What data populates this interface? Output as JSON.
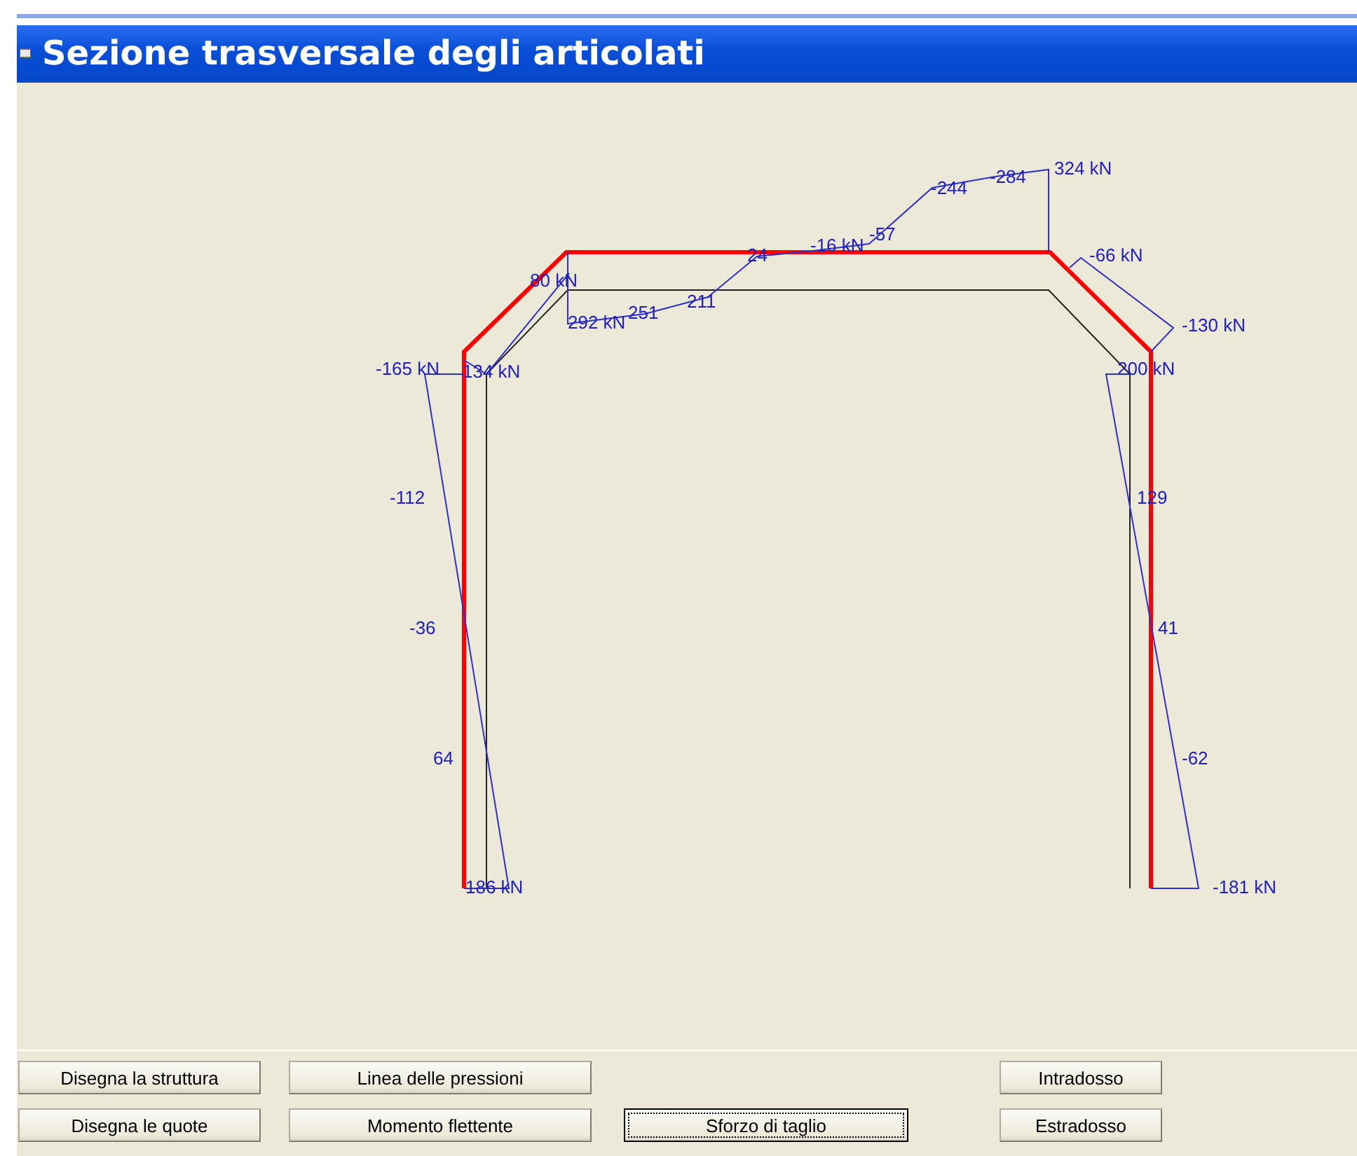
{
  "window": {
    "title": "Sezione trasversale degli articolati"
  },
  "diagram": {
    "labels": [
      {
        "text": "324 kN"
      },
      {
        "text": "-284"
      },
      {
        "text": "-244"
      },
      {
        "text": "-57"
      },
      {
        "text": "-16 kN"
      },
      {
        "text": "24"
      },
      {
        "text": "-66 kN"
      },
      {
        "text": "80 kN"
      },
      {
        "text": "211"
      },
      {
        "text": "251"
      },
      {
        "text": "292 kN"
      },
      {
        "text": "-130 kN"
      },
      {
        "text": "-165 kN"
      },
      {
        "text": "134 kN"
      },
      {
        "text": "200 kN"
      },
      {
        "text": "-112"
      },
      {
        "text": "129"
      },
      {
        "text": "-36"
      },
      {
        "text": "41"
      },
      {
        "text": "64"
      },
      {
        "text": "-62"
      },
      {
        "text": "186 kN"
      },
      {
        "text": "-181 kN"
      }
    ]
  },
  "buttons": [
    {
      "label": "Disegna la struttura",
      "selected": false
    },
    {
      "label": "Linea delle pressioni",
      "selected": false
    },
    {
      "label": "Intradosso",
      "selected": false
    },
    {
      "label": "Disegna le quote",
      "selected": false
    },
    {
      "label": "Momento flettente",
      "selected": false
    },
    {
      "label": "Sforzo di taglio",
      "selected": true
    },
    {
      "label": "Estradosso",
      "selected": false
    }
  ]
}
